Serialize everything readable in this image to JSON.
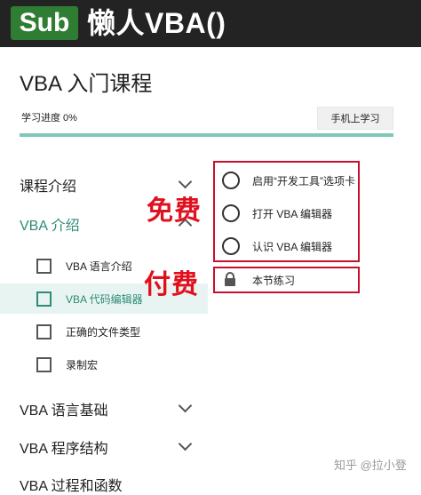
{
  "header": {
    "logo_text": "Sub",
    "title": "懒人VBA()"
  },
  "course": {
    "title": "VBA 入门课程",
    "progress_label": "学习进度 0%",
    "progress_value": 0,
    "mobile_button": "手机上学习"
  },
  "sections": [
    {
      "label": "课程介绍",
      "expanded": false
    },
    {
      "label": "VBA 介绍",
      "expanded": true
    },
    {
      "label": "VBA 语言基础",
      "expanded": false
    },
    {
      "label": "VBA 程序结构",
      "expanded": false
    },
    {
      "label": "VBA 过程和函数",
      "expanded": false
    }
  ],
  "lessons": [
    {
      "label": "VBA 语言介绍",
      "active": false
    },
    {
      "label": "VBA 代码编辑器",
      "active": true
    },
    {
      "label": "正确的文件类型",
      "active": false
    },
    {
      "label": "录制宏",
      "active": false
    }
  ],
  "items": {
    "free": [
      {
        "label": "启用“开发工具”选项卡"
      },
      {
        "label": "打开 VBA 编辑器"
      },
      {
        "label": "认识 VBA 编辑器"
      }
    ],
    "paid": [
      {
        "label": "本节练习"
      }
    ]
  },
  "annotations": {
    "free": "免费",
    "paid": "付费"
  },
  "watermark": "知乎 @拉小登",
  "colors": {
    "accent": "#2e8b75",
    "header_bg": "#232323",
    "logo_bg": "#2e7d32",
    "annotation": "#e0101e"
  }
}
